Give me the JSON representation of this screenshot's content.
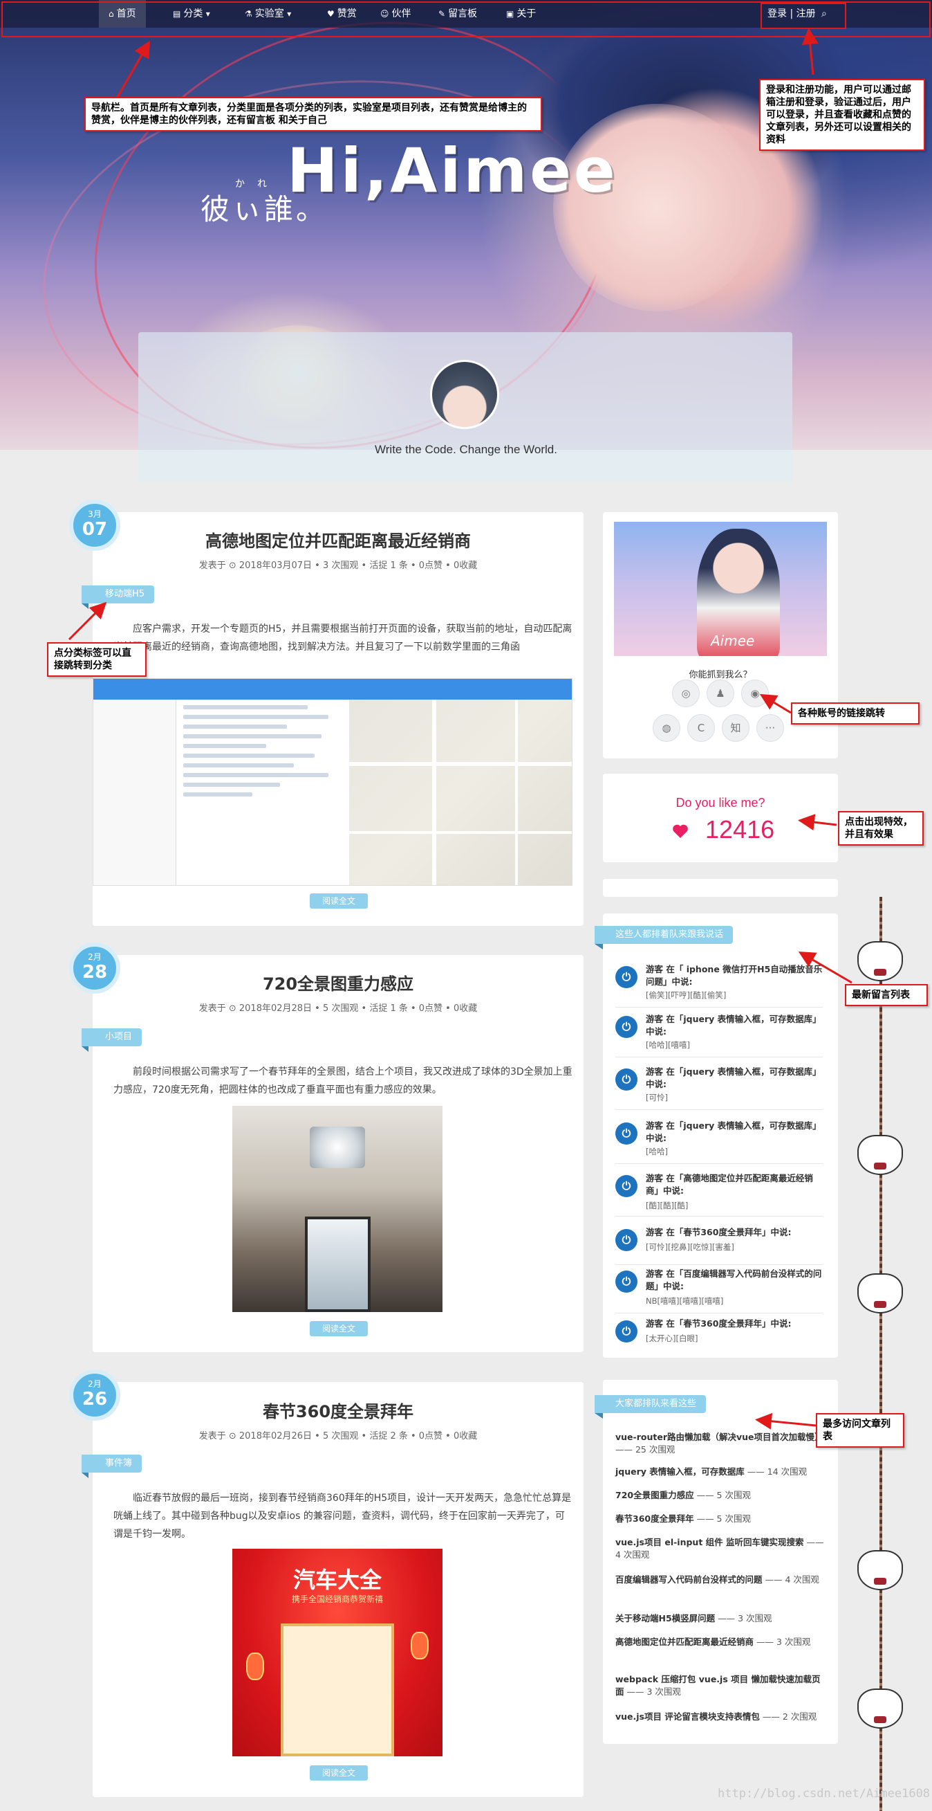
{
  "nav": {
    "items": [
      {
        "label": "首页",
        "icon": "home-icon"
      },
      {
        "label": "分类",
        "icon": "list-icon"
      },
      {
        "label": "实验室",
        "icon": "flask-icon"
      },
      {
        "label": "赞赏",
        "icon": "like-icon"
      },
      {
        "label": "伙伴",
        "icon": "users-icon"
      },
      {
        "label": "留言板",
        "icon": "pencil-icon"
      },
      {
        "label": "关于",
        "icon": "card-icon"
      }
    ],
    "login": "登录 | 注册"
  },
  "hero": {
    "title": "Hi,Aimee",
    "subtitle": "彼ぃ誰。",
    "subtitle_ruby": "かれ た",
    "motto": "Write the Code. Change the World."
  },
  "posts": [
    {
      "month": "3月",
      "day": "07",
      "title": "高德地图定位并匹配距离最近经销商",
      "meta": "发表于 ⊙ 2018年03月07日 • 3 次围观 • 活捉 1 条 • 0点赞 • 0收藏",
      "category": "移动端H5",
      "excerpt": "应客户需求，开发一个专题页的H5，并且需要根据当前打开页面的设备，获取当前的地址，自动匹配离当前距离最近的经销商，查询高德地图，找到解决方法。并且复习了一下以前数学里面的三角函",
      "read_more": "阅读全文>>"
    },
    {
      "month": "2月",
      "day": "28",
      "title": "720全景图重力感应",
      "meta": "发表于 ⊙ 2018年02月28日 • 5 次围观 • 活捉 1 条 • 0点赞 • 0收藏",
      "category": "小项目",
      "excerpt": "前段时间根据公司需求写了一个春节拜年的全景图，结合上个项目，我又改进成了球体的3D全景加上重力感应，720度无死角，把圆柱体的也改成了垂直平面也有重力感应的效果。",
      "read_more": "阅读全文>>"
    },
    {
      "month": "2月",
      "day": "26",
      "title": "春节360度全景拜年",
      "meta": "发表于 ⊙ 2018年02月26日 • 5 次围观 • 活捉 2 条 • 0点赞 • 0收藏",
      "category": "事件簿",
      "excerpt": "临近春节放假的最后一班岗，接到春节经销商360拜年的H5项目，设计一天开发两天，急急忙忙总算是咣蛹上线了。其中碰到各种bug以及安卓ios 的兼容问题，查资料，调代码，终于在回家前一天弄完了，可谓是千钧一发啊。",
      "read_more": "阅读全文>>",
      "image_brand": "汽车大全",
      "image_slogan": "携手全国经销商恭贺新禧"
    }
  ],
  "sidebar": {
    "profile_signature": "Aimee",
    "find_me": "你能抓到我么？",
    "social": [
      {
        "icon": "github-icon",
        "glyph": "◎"
      },
      {
        "icon": "qq-icon",
        "glyph": "♟"
      },
      {
        "icon": "weibo-icon",
        "glyph": "◉"
      },
      {
        "icon": "wechat-icon",
        "glyph": "◍"
      },
      {
        "icon": "csdn-icon",
        "glyph": "C"
      },
      {
        "icon": "zhihu-icon",
        "glyph": "知"
      },
      {
        "icon": "more-icon",
        "glyph": "···"
      }
    ],
    "like_question": "Do you like me?",
    "like_count": "12416",
    "comments_title": "这些人都排着队来跟我说话",
    "comments": [
      {
        "title": "游客 在「 iphone 微信打开H5自动播放音乐问题」中说:",
        "body": "[偷笑][吓哼][酷][偷笑]"
      },
      {
        "title": "游客 在「jquery 表情输入框，可存数据库」中说:",
        "body": "[哈哈][嘻嘻]"
      },
      {
        "title": "游客 在「jquery 表情输入框，可存数据库」中说:",
        "body": "[可怜]"
      },
      {
        "title": "游客 在「jquery 表情输入框，可存数据库」中说:",
        "body": "[哈哈]"
      },
      {
        "title": "游客 在「高德地图定位并匹配距离最近经销商」中说:",
        "body": "[酷][酷][酷]"
      },
      {
        "title": "游客 在「春节360度全景拜年」中说:",
        "body": "[可怜][挖鼻][吃惊][害羞]"
      },
      {
        "title": "游客 在「百度编辑器写入代码前台没样式的问题」中说:",
        "body": "NB[嘻嘻][嘻嘻][嘻嘻]"
      },
      {
        "title": "游客 在「春节360度全景拜年」中说:",
        "body": "[太开心][白眼]"
      }
    ],
    "top_title": "大家都排队来看这些",
    "top_posts": [
      {
        "name": "vue-router路由懒加载（解决vue项目首次加载慢）",
        "views": "—— 25 次围观"
      },
      {
        "name": "jquery 表情输入框，可存数据库",
        "views": "—— 14 次围观"
      },
      {
        "name": "720全景图重力感应",
        "views": "—— 5 次围观"
      },
      {
        "name": "春节360度全景拜年",
        "views": "—— 5 次围观"
      },
      {
        "name": "vue.js项目 el-input 组件 监听回车键实现搜索",
        "views": "—— 4 次围观"
      },
      {
        "name": "百度编辑器写入代码前台没样式的问题",
        "views": "—— 4 次围观"
      },
      {
        "name": "关于移动端H5横竖屏问题",
        "views": "—— 3 次围观"
      },
      {
        "name": "高德地图定位并匹配距离最近经销商",
        "views": "—— 3 次围观"
      },
      {
        "name": "webpack 压缩打包 vue.js 项目 懒加载快速加载页面",
        "views": "—— 3 次围观"
      },
      {
        "name": "vue.js项目 评论留言模块支持表情包",
        "views": "—— 2 次围观"
      }
    ]
  },
  "annotations": {
    "nav": "导航栏。首页是所有文章列表，分类里面是各项分类的列表，实验室是项目列表，还有赞赏是给博主的赞赏，伙伴是博主的伙伴列表，还有留言板 和关于自己",
    "login": "登录和注册功能，用户可以通过邮箱注册和登录，验证通过后，用户可以登录，并且查看收藏和点赞的文章列表，另外还可以设置相关的资料",
    "category": "点分类标签可以直接跳转到分类",
    "social": "各种账号的链接跳转",
    "like": "点击出现特效，并且有效果",
    "comments": "最新留言列表",
    "top": "最多访问文章列表"
  },
  "watermark": "http://blog.csdn.net/Aimee1608",
  "colors": {
    "accent": "#8fd0ec",
    "date_badge": "#5bb8e6",
    "like": "#e91e63",
    "annotation": "#e01a1a"
  }
}
